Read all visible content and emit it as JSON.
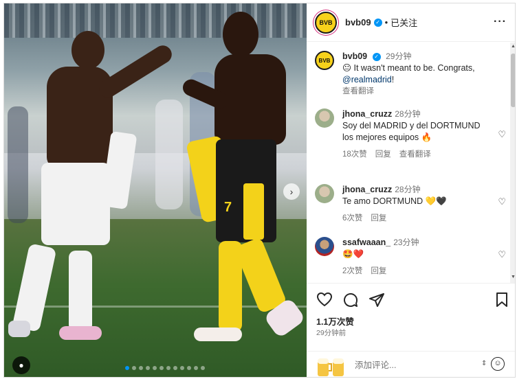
{
  "post": {
    "username": "bvb09",
    "follow_state": "已关注",
    "header_dot": "•",
    "more_icon": "more-horizontal-icon",
    "caption": {
      "username": "bvb09",
      "time": "29分钟",
      "emoji": "😐",
      "text": "It wasn't meant to be. Congrats,",
      "mention": "@realmadrid",
      "text_end": "!",
      "translate": "查看翻译"
    },
    "comments": [
      {
        "username": "jhona_cruzz",
        "time": "28分钟",
        "text": "Soy del MADRID y del DORTMUND los mejores equipos 🔥",
        "likes": "18次赞",
        "reply": "回复",
        "translate": "查看翻译"
      },
      {
        "username": "jhona_cruzz",
        "time": "28分钟",
        "text": "Te amo DORTMUND 💛🖤",
        "likes": "6次赞",
        "reply": "回复"
      },
      {
        "username": "ssafwaaan_",
        "time": "23分钟",
        "text": "🤩❤️",
        "likes": "2次赞",
        "reply": "回复"
      }
    ],
    "likes_count": "1.1万次赞",
    "posted_time": "29分钟前",
    "comment_placeholder": "添加评论...",
    "logo_text": "BVB"
  },
  "media": {
    "carousel_count": 12,
    "active_index": 0,
    "next_arrow": "›",
    "shorts_number": "7"
  },
  "icons": [
    "heart-icon",
    "comment-icon",
    "share-icon",
    "bookmark-icon",
    "emoji-icon"
  ],
  "colors": {
    "accent": "#0095f6",
    "bvb_yellow": "#f7d21b",
    "mention": "#00376b",
    "muted": "#737373"
  }
}
